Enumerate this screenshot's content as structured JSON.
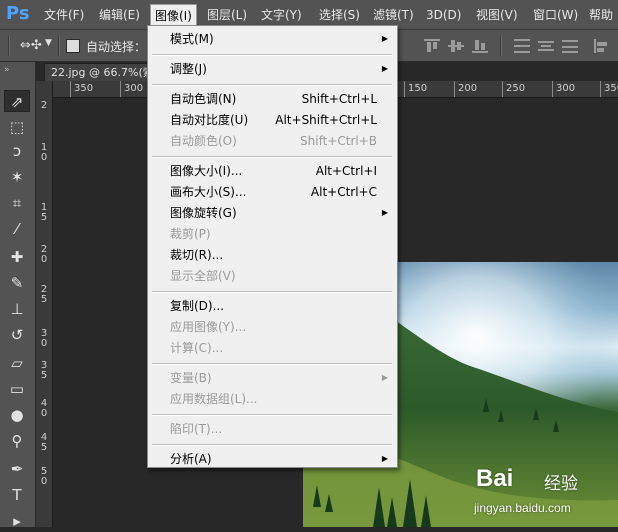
{
  "app": {
    "logo": "Ps"
  },
  "menubar": {
    "items": [
      "文件(F)",
      "编辑(E)",
      "图像(I)",
      "图层(L)",
      "文字(Y)",
      "选择(S)",
      "滤镜(T)",
      "3D(D)",
      "视图(V)",
      "窗口(W)",
      "帮助"
    ],
    "active_index": 2
  },
  "options_bar": {
    "auto_select_label": "自动选择："
  },
  "document": {
    "tab_title": "22.jpg @ 66.7%(索"
  },
  "ruler": {
    "top_ticks": [
      "350",
      "300",
      "150",
      "200",
      "250",
      "300",
      "350"
    ],
    "left_ticks": [
      "2",
      "1",
      "0",
      "1",
      "5",
      "2",
      "0",
      "2",
      "5",
      "3",
      "0",
      "3",
      "5",
      "4",
      "0",
      "4",
      "5",
      "5",
      "0"
    ]
  },
  "image_menu": {
    "items": [
      {
        "label": "模式(M)",
        "shortcut": "",
        "submenu": true,
        "disabled": false
      },
      {
        "sep": true
      },
      {
        "label": "调整(J)",
        "shortcut": "",
        "submenu": true,
        "disabled": false
      },
      {
        "sep": true
      },
      {
        "label": "自动色调(N)",
        "shortcut": "Shift+Ctrl+L",
        "submenu": false,
        "disabled": false
      },
      {
        "label": "自动对比度(U)",
        "shortcut": "Alt+Shift+Ctrl+L",
        "submenu": false,
        "disabled": false
      },
      {
        "label": "自动颜色(O)",
        "shortcut": "Shift+Ctrl+B",
        "submenu": false,
        "disabled": true
      },
      {
        "sep": true
      },
      {
        "label": "图像大小(I)...",
        "shortcut": "Alt+Ctrl+I",
        "submenu": false,
        "disabled": false
      },
      {
        "label": "画布大小(S)...",
        "shortcut": "Alt+Ctrl+C",
        "submenu": false,
        "disabled": false
      },
      {
        "label": "图像旋转(G)",
        "shortcut": "",
        "submenu": true,
        "disabled": false
      },
      {
        "label": "裁剪(P)",
        "shortcut": "",
        "submenu": false,
        "disabled": true
      },
      {
        "label": "裁切(R)...",
        "shortcut": "",
        "submenu": false,
        "disabled": false
      },
      {
        "label": "显示全部(V)",
        "shortcut": "",
        "submenu": false,
        "disabled": true
      },
      {
        "sep": true
      },
      {
        "label": "复制(D)...",
        "shortcut": "",
        "submenu": false,
        "disabled": false
      },
      {
        "label": "应用图像(Y)...",
        "shortcut": "",
        "submenu": false,
        "disabled": true
      },
      {
        "label": "计算(C)...",
        "shortcut": "",
        "submenu": false,
        "disabled": true
      },
      {
        "sep": true
      },
      {
        "label": "变量(B)",
        "shortcut": "",
        "submenu": true,
        "disabled": true
      },
      {
        "label": "应用数据组(L)...",
        "shortcut": "",
        "submenu": false,
        "disabled": true
      },
      {
        "sep": true
      },
      {
        "label": "陷印(T)...",
        "shortcut": "",
        "submenu": false,
        "disabled": true
      },
      {
        "sep": true
      },
      {
        "label": "分析(A)",
        "shortcut": "",
        "submenu": true,
        "disabled": false
      }
    ]
  },
  "tools": [
    {
      "icon": "move-tool-icon",
      "glyph": "⇗",
      "selected": true
    },
    {
      "icon": "marquee-tool-icon",
      "glyph": "⬚",
      "selected": false
    },
    {
      "icon": "lasso-tool-icon",
      "glyph": "ↄ",
      "selected": false
    },
    {
      "icon": "magic-wand-tool-icon",
      "glyph": "✶",
      "selected": false
    },
    {
      "icon": "crop-tool-icon",
      "glyph": "⌗",
      "selected": false
    },
    {
      "icon": "eyedropper-tool-icon",
      "glyph": "⁄",
      "selected": false
    },
    {
      "icon": "healing-brush-tool-icon",
      "glyph": "✚",
      "selected": false
    },
    {
      "icon": "brush-tool-icon",
      "glyph": "✎",
      "selected": false
    },
    {
      "icon": "clone-stamp-tool-icon",
      "glyph": "⊥",
      "selected": false
    },
    {
      "icon": "history-brush-tool-icon",
      "glyph": "↺",
      "selected": false
    },
    {
      "icon": "eraser-tool-icon",
      "glyph": "▱",
      "selected": false
    },
    {
      "icon": "gradient-tool-icon",
      "glyph": "▭",
      "selected": false
    },
    {
      "icon": "blur-tool-icon",
      "glyph": "●",
      "selected": false
    },
    {
      "icon": "dodge-tool-icon",
      "glyph": "⚲",
      "selected": false
    },
    {
      "icon": "pen-tool-icon",
      "glyph": "✒",
      "selected": false
    },
    {
      "icon": "type-tool-icon",
      "glyph": "T",
      "selected": false
    },
    {
      "icon": "path-selection-tool-icon",
      "glyph": "▸",
      "selected": false
    }
  ],
  "watermark": {
    "brand": "Bai",
    "brand_suffix": "经验",
    "url": "jingyan.baidu.com"
  },
  "colors": {
    "ui_dark": "#535353",
    "canvas_bg": "#282828",
    "menu_bg": "#f0f0f0",
    "ps_blue": "#4fa3ff"
  }
}
